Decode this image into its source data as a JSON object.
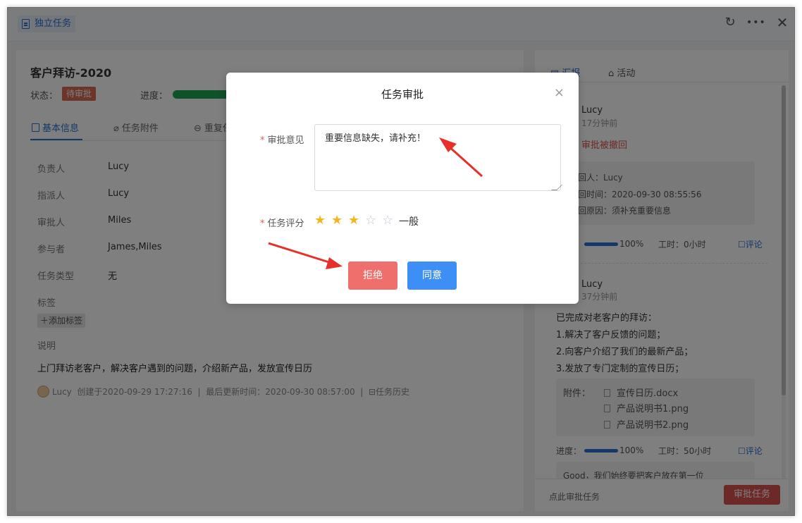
{
  "header": {
    "tag_label": "独立任务",
    "icons": [
      "refresh-icon",
      "more-icon",
      "close-icon"
    ]
  },
  "task": {
    "title": "客户拜访-2020",
    "status_label": "状态：",
    "status_value": "待审批",
    "progress_label": "进度："
  },
  "tabs": [
    {
      "label": "基本信息",
      "active": true
    },
    {
      "label": "任务附件"
    },
    {
      "label": "重复任"
    }
  ],
  "fields": [
    {
      "label": "负责人",
      "value": "Lucy"
    },
    {
      "label": "指派人",
      "value": "Lucy"
    },
    {
      "label": "审批人",
      "value": "Miles"
    },
    {
      "label": "参与者",
      "value": "James,Miles"
    },
    {
      "label": "任务类型",
      "value": "无"
    }
  ],
  "tags_label": "标签",
  "add_tag_label": "添加标签",
  "desc_label": "说明",
  "description": "上门拜访老客户，解决客户遇到的问题，介绍新产品，发放宣传日历",
  "footer": {
    "user": "Lucy",
    "created": "创建于2020-09-29 17:27:16",
    "updated": "最后更新时间：2020-09-30 08:57:00",
    "history": "任务历史"
  },
  "right": {
    "tabs": [
      "汇报",
      "活动"
    ],
    "entry1": {
      "name": "Lucy",
      "time": "17分钟前",
      "status": "审批被撤回",
      "box_lines": [
        "回人：Lucy",
        "回时间：2020-09-30 08:55:56",
        "回原因：须补充重要信息"
      ],
      "progress": "100%",
      "hours": "工时：0小时",
      "comment": "评论"
    },
    "entry2": {
      "name": "Lucy",
      "time": "37分钟前",
      "lines": [
        "已完成对老客户的拜访：",
        "1.解决了客户反馈的问题；",
        "2.向客户介绍了我们的最新产品；",
        "3.发放了专门定制的宣传日历；"
      ],
      "attach_label": "附件：",
      "files": [
        "宣传日历.docx",
        "产品说明书1.png",
        "产品说明书2.png"
      ],
      "progress_label": "进度：",
      "progress": "100%",
      "hours": "工时：50小时",
      "comment": "评论",
      "reply": "Good，我们始终要把客户放在第一位"
    },
    "footer_text": "点此审批任务",
    "approve_btn": "审批任务"
  },
  "modal": {
    "title": "任务审批",
    "opinion_label": "审批意见",
    "opinion_value": "重要信息缺失，请补充！",
    "rating_label": "任务评分",
    "rating_value": 3,
    "rating_max": 5,
    "rating_text": "一般",
    "reject_label": "拒绝",
    "agree_label": "同意"
  },
  "colors": {
    "accent": "#2a6ed3",
    "reject": "#ef6f6c",
    "agree": "#3d8ff5",
    "star": "#f6b51e",
    "arrow": "#e8302a"
  }
}
